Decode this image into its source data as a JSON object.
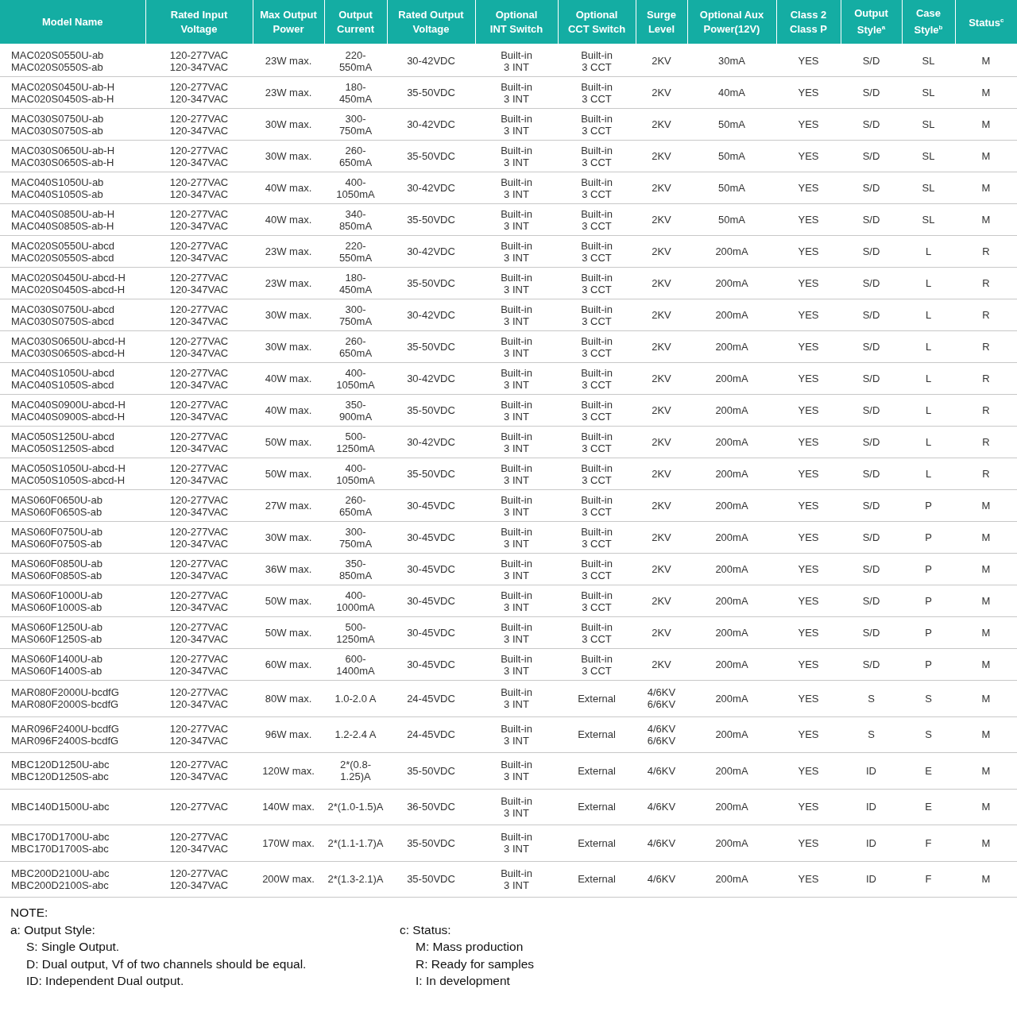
{
  "table": {
    "columns": [
      "Model Name",
      "Rated Input\nVoltage",
      "Max Output\nPower",
      "Output\nCurrent",
      "Rated Output\nVoltage",
      "Optional\nINT Switch",
      "Optional\nCCT Switch",
      "Surge\nLevel",
      "Optional Aux\nPower(12V)",
      "Class 2\nClass P",
      "Output\nStyle$^{a}$",
      "Case\nStyle$^{b}$",
      "Status$^{c}$"
    ],
    "rows": [
      [
        "MAC020S0550U-ab\nMAC020S0550S-ab",
        "120-277VAC\n120-347VAC",
        "23W max.",
        "220-\n550mA",
        "30-42VDC",
        "Built-in\n3 INT",
        "Built-in\n3 CCT",
        "2KV",
        "30mA",
        "YES",
        "S/D",
        "SL",
        "M"
      ],
      [
        "MAC020S0450U-ab-H\nMAC020S0450S-ab-H",
        "120-277VAC\n120-347VAC",
        "23W max.",
        "180-\n450mA",
        "35-50VDC",
        "Built-in\n3 INT",
        "Built-in\n3 CCT",
        "2KV",
        "40mA",
        "YES",
        "S/D",
        "SL",
        "M"
      ],
      [
        "MAC030S0750U-ab\nMAC030S0750S-ab",
        "120-277VAC\n120-347VAC",
        "30W max.",
        "300-\n750mA",
        "30-42VDC",
        "Built-in\n3 INT",
        "Built-in\n3 CCT",
        "2KV",
        "50mA",
        "YES",
        "S/D",
        "SL",
        "M"
      ],
      [
        "MAC030S0650U-ab-H\nMAC030S0650S-ab-H",
        "120-277VAC\n120-347VAC",
        "30W max.",
        "260-\n650mA",
        "35-50VDC",
        "Built-in\n3 INT",
        "Built-in\n3 CCT",
        "2KV",
        "50mA",
        "YES",
        "S/D",
        "SL",
        "M"
      ],
      [
        "MAC040S1050U-ab\nMAC040S1050S-ab",
        "120-277VAC\n120-347VAC",
        "40W max.",
        "400-\n1050mA",
        "30-42VDC",
        "Built-in\n3 INT",
        "Built-in\n3 CCT",
        "2KV",
        "50mA",
        "YES",
        "S/D",
        "SL",
        "M"
      ],
      [
        "MAC040S0850U-ab-H\nMAC040S0850S-ab-H",
        "120-277VAC\n120-347VAC",
        "40W max.",
        "340-\n850mA",
        "35-50VDC",
        "Built-in\n3 INT",
        "Built-in\n3 CCT",
        "2KV",
        "50mA",
        "YES",
        "S/D",
        "SL",
        "M"
      ],
      [
        "MAC020S0550U-abcd\nMAC020S0550S-abcd",
        "120-277VAC\n120-347VAC",
        "23W max.",
        "220-\n550mA",
        "30-42VDC",
        "Built-in\n3 INT",
        "Built-in\n3 CCT",
        "2KV",
        "200mA",
        "YES",
        "S/D",
        "L",
        "R"
      ],
      [
        "MAC020S0450U-abcd-H\nMAC020S0450S-abcd-H",
        "120-277VAC\n120-347VAC",
        "23W max.",
        "180-\n450mA",
        "35-50VDC",
        "Built-in\n3 INT",
        "Built-in\n3 CCT",
        "2KV",
        "200mA",
        "YES",
        "S/D",
        "L",
        "R"
      ],
      [
        "MAC030S0750U-abcd\nMAC030S0750S-abcd",
        "120-277VAC\n120-347VAC",
        "30W max.",
        "300-\n750mA",
        "30-42VDC",
        "Built-in\n3 INT",
        "Built-in\n3 CCT",
        "2KV",
        "200mA",
        "YES",
        "S/D",
        "L",
        "R"
      ],
      [
        "MAC030S0650U-abcd-H\nMAC030S0650S-abcd-H",
        "120-277VAC\n120-347VAC",
        "30W max.",
        "260-\n650mA",
        "35-50VDC",
        "Built-in\n3 INT",
        "Built-in\n3 CCT",
        "2KV",
        "200mA",
        "YES",
        "S/D",
        "L",
        "R"
      ],
      [
        "MAC040S1050U-abcd\nMAC040S1050S-abcd",
        "120-277VAC\n120-347VAC",
        "40W max.",
        "400-\n1050mA",
        "30-42VDC",
        "Built-in\n3 INT",
        "Built-in\n3 CCT",
        "2KV",
        "200mA",
        "YES",
        "S/D",
        "L",
        "R"
      ],
      [
        "MAC040S0900U-abcd-H\nMAC040S0900S-abcd-H",
        "120-277VAC\n120-347VAC",
        "40W max.",
        "350-\n900mA",
        "35-50VDC",
        "Built-in\n3 INT",
        "Built-in\n3 CCT",
        "2KV",
        "200mA",
        "YES",
        "S/D",
        "L",
        "R"
      ],
      [
        "MAC050S1250U-abcd\nMAC050S1250S-abcd",
        "120-277VAC\n120-347VAC",
        "50W max.",
        "500-\n1250mA",
        "30-42VDC",
        "Built-in\n3 INT",
        "Built-in\n3 CCT",
        "2KV",
        "200mA",
        "YES",
        "S/D",
        "L",
        "R"
      ],
      [
        "MAC050S1050U-abcd-H\nMAC050S1050S-abcd-H",
        "120-277VAC\n120-347VAC",
        "50W max.",
        "400-\n1050mA",
        "35-50VDC",
        "Built-in\n3 INT",
        "Built-in\n3 CCT",
        "2KV",
        "200mA",
        "YES",
        "S/D",
        "L",
        "R"
      ],
      [
        "MAS060F0650U-ab\nMAS060F0650S-ab",
        "120-277VAC\n120-347VAC",
        "27W max.",
        "260-\n650mA",
        "30-45VDC",
        "Built-in\n3 INT",
        "Built-in\n3 CCT",
        "2KV",
        "200mA",
        "YES",
        "S/D",
        "P",
        "M"
      ],
      [
        "MAS060F0750U-ab\nMAS060F0750S-ab",
        "120-277VAC\n120-347VAC",
        "30W max.",
        "300-\n750mA",
        "30-45VDC",
        "Built-in\n3 INT",
        "Built-in\n3 CCT",
        "2KV",
        "200mA",
        "YES",
        "S/D",
        "P",
        "M"
      ],
      [
        "MAS060F0850U-ab\nMAS060F0850S-ab",
        "120-277VAC\n120-347VAC",
        "36W max.",
        "350-\n850mA",
        "30-45VDC",
        "Built-in\n3 INT",
        "Built-in\n3 CCT",
        "2KV",
        "200mA",
        "YES",
        "S/D",
        "P",
        "M"
      ],
      [
        "MAS060F1000U-ab\nMAS060F1000S-ab",
        "120-277VAC\n120-347VAC",
        "50W max.",
        "400-\n1000mA",
        "30-45VDC",
        "Built-in\n3 INT",
        "Built-in\n3 CCT",
        "2KV",
        "200mA",
        "YES",
        "S/D",
        "P",
        "M"
      ],
      [
        "MAS060F1250U-ab\nMAS060F1250S-ab",
        "120-277VAC\n120-347VAC",
        "50W max.",
        "500-\n1250mA",
        "30-45VDC",
        "Built-in\n3 INT",
        "Built-in\n3 CCT",
        "2KV",
        "200mA",
        "YES",
        "S/D",
        "P",
        "M"
      ],
      [
        "MAS060F1400U-ab\nMAS060F1400S-ab",
        "120-277VAC\n120-347VAC",
        "60W max.",
        "600-\n1400mA",
        "30-45VDC",
        "Built-in\n3 INT",
        "Built-in\n3 CCT",
        "2KV",
        "200mA",
        "YES",
        "S/D",
        "P",
        "M"
      ],
      [
        "MAR080F2000U-bcdfG\nMAR080F2000S-bcdfG",
        "120-277VAC\n120-347VAC",
        "80W max.",
        "1.0-2.0 A",
        "24-45VDC",
        "Built-in\n3 INT",
        "External",
        "4/6KV\n6/6KV",
        "200mA",
        "YES",
        "S",
        "S",
        "M"
      ],
      [
        "MAR096F2400U-bcdfG\nMAR096F2400S-bcdfG",
        "120-277VAC\n120-347VAC",
        "96W max.",
        "1.2-2.4 A",
        "24-45VDC",
        "Built-in\n3 INT",
        "External",
        "4/6KV\n6/6KV",
        "200mA",
        "YES",
        "S",
        "S",
        "M"
      ],
      [
        "MBC120D1250U-abc\nMBC120D1250S-abc",
        "120-277VAC\n120-347VAC",
        "120W max.",
        "2*(0.8-1.25)A",
        "35-50VDC",
        "Built-in\n3 INT",
        "External",
        "4/6KV",
        "200mA",
        "YES",
        "ID",
        "E",
        "M"
      ],
      [
        "MBC140D1500U-abc",
        "120-277VAC",
        "140W max.",
        "2*(1.0-1.5)A",
        "36-50VDC",
        "Built-in\n3 INT",
        "External",
        "4/6KV",
        "200mA",
        "YES",
        "ID",
        "E",
        "M"
      ],
      [
        "MBC170D1700U-abc\nMBC170D1700S-abc",
        "120-277VAC\n120-347VAC",
        "170W max.",
        "2*(1.1-1.7)A",
        "35-50VDC",
        "Built-in\n3 INT",
        "External",
        "4/6KV",
        "200mA",
        "YES",
        "ID",
        "F",
        "M"
      ],
      [
        "MBC200D2100U-abc\nMBC200D2100S-abc",
        "120-277VAC\n120-347VAC",
        "200W max.",
        "2*(1.3-2.1)A",
        "35-50VDC",
        "Built-in\n3 INT",
        "External",
        "4/6KV",
        "200mA",
        "YES",
        "ID",
        "F",
        "M"
      ]
    ]
  },
  "notes": {
    "title": "NOTE:",
    "groups": [
      {
        "heading": "a: Output Style:",
        "items": [
          "S: Single Output.",
          "D: Dual output, Vf of two channels should be equal.",
          "ID: Independent Dual output."
        ]
      },
      {
        "heading": "c: Status:",
        "items": [
          "M: Mass production",
          "R: Ready for samples",
          "I: In development"
        ]
      }
    ]
  }
}
